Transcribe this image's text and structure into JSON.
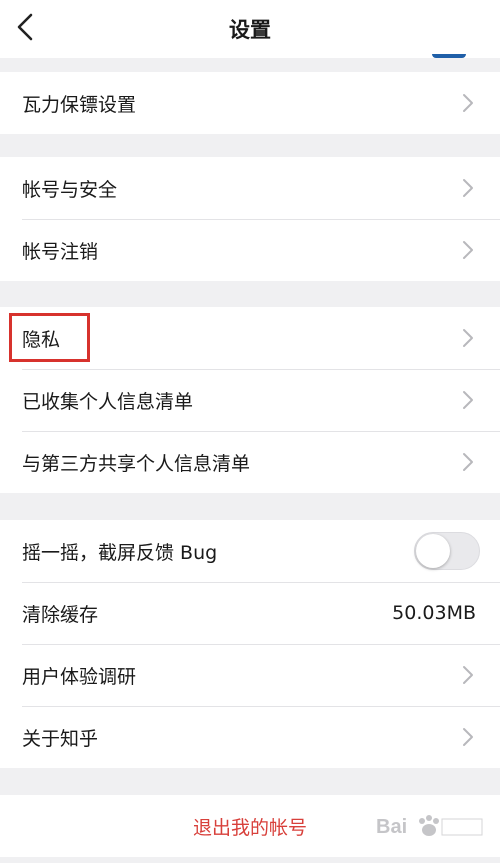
{
  "nav": {
    "title": "设置"
  },
  "groups": [
    {
      "rows": [
        {
          "label": "瓦力保镖设置",
          "type": "chevron"
        }
      ]
    },
    {
      "rows": [
        {
          "label": "帐号与安全",
          "type": "chevron"
        },
        {
          "label": "帐号注销",
          "type": "chevron"
        }
      ]
    },
    {
      "rows": [
        {
          "label": "隐私",
          "type": "chevron"
        },
        {
          "label": "已收集个人信息清单",
          "type": "chevron"
        },
        {
          "label": "与第三方共享个人信息清单",
          "type": "chevron"
        }
      ]
    },
    {
      "rows": [
        {
          "label": "摇一摇，截屏反馈 Bug",
          "type": "toggle",
          "on": false
        },
        {
          "label": "清除缓存",
          "type": "value",
          "value": "50.03MB"
        },
        {
          "label": "用户体验调研",
          "type": "chevron"
        },
        {
          "label": "关于知乎",
          "type": "chevron"
        }
      ]
    }
  ],
  "logout_label": "退出我的帐号",
  "colors": {
    "accent_red": "#d8403b",
    "highlight": "#d7322d",
    "background": "#f0f0f2"
  }
}
